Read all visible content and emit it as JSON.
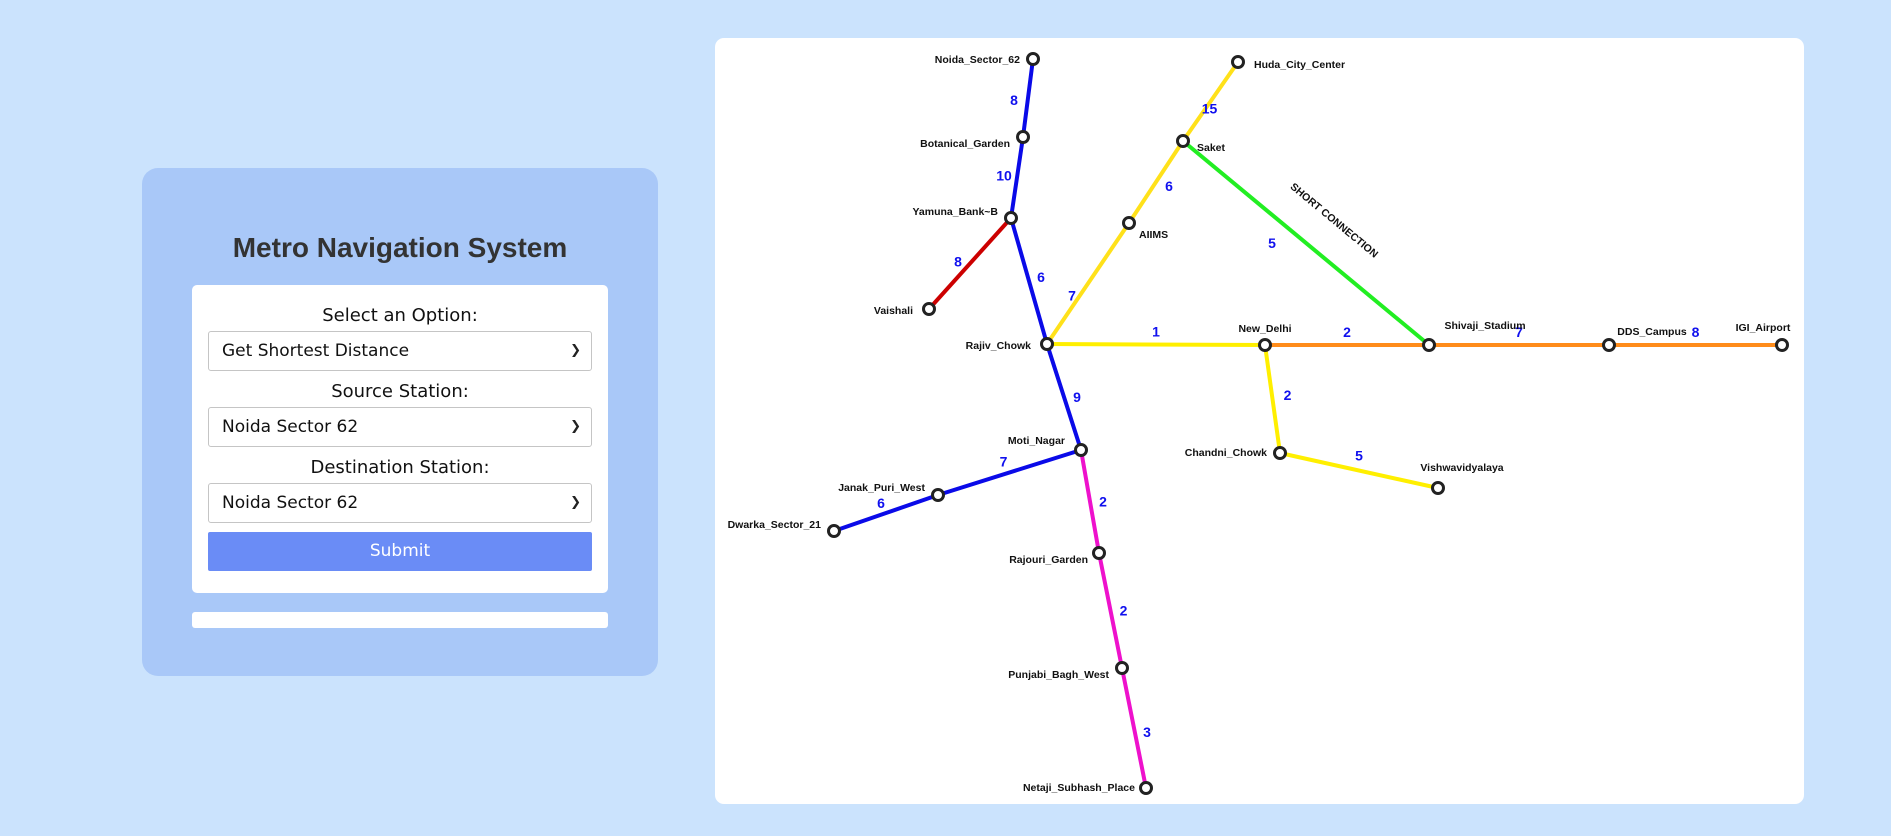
{
  "app": {
    "title": "Metro Navigation System"
  },
  "form": {
    "option_label": "Select an Option:",
    "option_value": "Get Shortest Distance",
    "source_label": "Source Station:",
    "source_value": "Noida Sector 62",
    "destination_label": "Destination Station:",
    "destination_value": "Noida Sector 62",
    "submit_label": "Submit"
  },
  "result": {
    "text": ""
  },
  "map": {
    "colors": {
      "blue": "#0a0ae8",
      "red": "#cc0000",
      "yellow": "#ffe11a",
      "yellow_bright": "#ffef00",
      "green": "#22ee22",
      "orange": "#ff8c1a",
      "magenta": "#ee11cc",
      "weight": "#1010ee",
      "station_stroke": "#222222"
    },
    "stations": [
      {
        "id": "noida",
        "name": "Noida_Sector_62"
      },
      {
        "id": "botanical",
        "name": "Botanical_Garden"
      },
      {
        "id": "yamuna",
        "name": "Yamuna_Bank~B"
      },
      {
        "id": "vaishali",
        "name": "Vaishali"
      },
      {
        "id": "rajiv",
        "name": "Rajiv_Chowk"
      },
      {
        "id": "moti",
        "name": "Moti_Nagar"
      },
      {
        "id": "janak",
        "name": "Janak_Puri_West"
      },
      {
        "id": "dwarka",
        "name": "Dwarka_Sector_21"
      },
      {
        "id": "rajouri",
        "name": "Rajouri_Garden"
      },
      {
        "id": "punjabi",
        "name": "Punjabi_Bagh_West"
      },
      {
        "id": "netaji",
        "name": "Netaji_Subhash_Place"
      },
      {
        "id": "huda",
        "name": "Huda_City_Center"
      },
      {
        "id": "saket",
        "name": "Saket"
      },
      {
        "id": "aiims",
        "name": "AIIMS"
      },
      {
        "id": "newdelhi",
        "name": "New_Delhi"
      },
      {
        "id": "chandni",
        "name": "Chandni_Chowk"
      },
      {
        "id": "vishwa",
        "name": "Vishwavidyalaya"
      },
      {
        "id": "shivaji",
        "name": "Shivaji_Stadium"
      },
      {
        "id": "dds",
        "name": "DDS_Campus"
      },
      {
        "id": "igi",
        "name": "IGI_Airport"
      }
    ],
    "edges": [
      {
        "from": "noida",
        "to": "botanical",
        "weight": "8",
        "line": "blue"
      },
      {
        "from": "botanical",
        "to": "yamuna",
        "weight": "10",
        "line": "blue"
      },
      {
        "from": "yamuna",
        "to": "vaishali",
        "weight": "8",
        "line": "red"
      },
      {
        "from": "yamuna",
        "to": "rajiv",
        "weight": "6",
        "line": "blue"
      },
      {
        "from": "rajiv",
        "to": "moti",
        "weight": "9",
        "line": "blue"
      },
      {
        "from": "moti",
        "to": "janak",
        "weight": "7",
        "line": "blue"
      },
      {
        "from": "janak",
        "to": "dwarka",
        "weight": "6",
        "line": "blue"
      },
      {
        "from": "moti",
        "to": "rajouri",
        "weight": "2",
        "line": "magenta"
      },
      {
        "from": "rajouri",
        "to": "punjabi",
        "weight": "2",
        "line": "magenta"
      },
      {
        "from": "punjabi",
        "to": "netaji",
        "weight": "3",
        "line": "magenta"
      },
      {
        "from": "huda",
        "to": "saket",
        "weight": "15",
        "line": "yellow"
      },
      {
        "from": "saket",
        "to": "aiims",
        "weight": "6",
        "line": "yellow"
      },
      {
        "from": "aiims",
        "to": "rajiv",
        "weight": "7",
        "line": "yellow"
      },
      {
        "from": "saket",
        "to": "shivaji",
        "weight": "5",
        "line": "green",
        "label": "SHORT CONNECTION"
      },
      {
        "from": "rajiv",
        "to": "newdelhi",
        "weight": "1",
        "line": "yellow_bright"
      },
      {
        "from": "newdelhi",
        "to": "shivaji",
        "weight": "2",
        "line": "orange"
      },
      {
        "from": "newdelhi",
        "to": "chandni",
        "weight": "2",
        "line": "yellow_bright"
      },
      {
        "from": "chandni",
        "to": "vishwa",
        "weight": "5",
        "line": "yellow_bright"
      },
      {
        "from": "shivaji",
        "to": "dds",
        "weight": "7",
        "line": "orange"
      },
      {
        "from": "dds",
        "to": "igi",
        "weight": "8",
        "line": "orange"
      }
    ]
  }
}
